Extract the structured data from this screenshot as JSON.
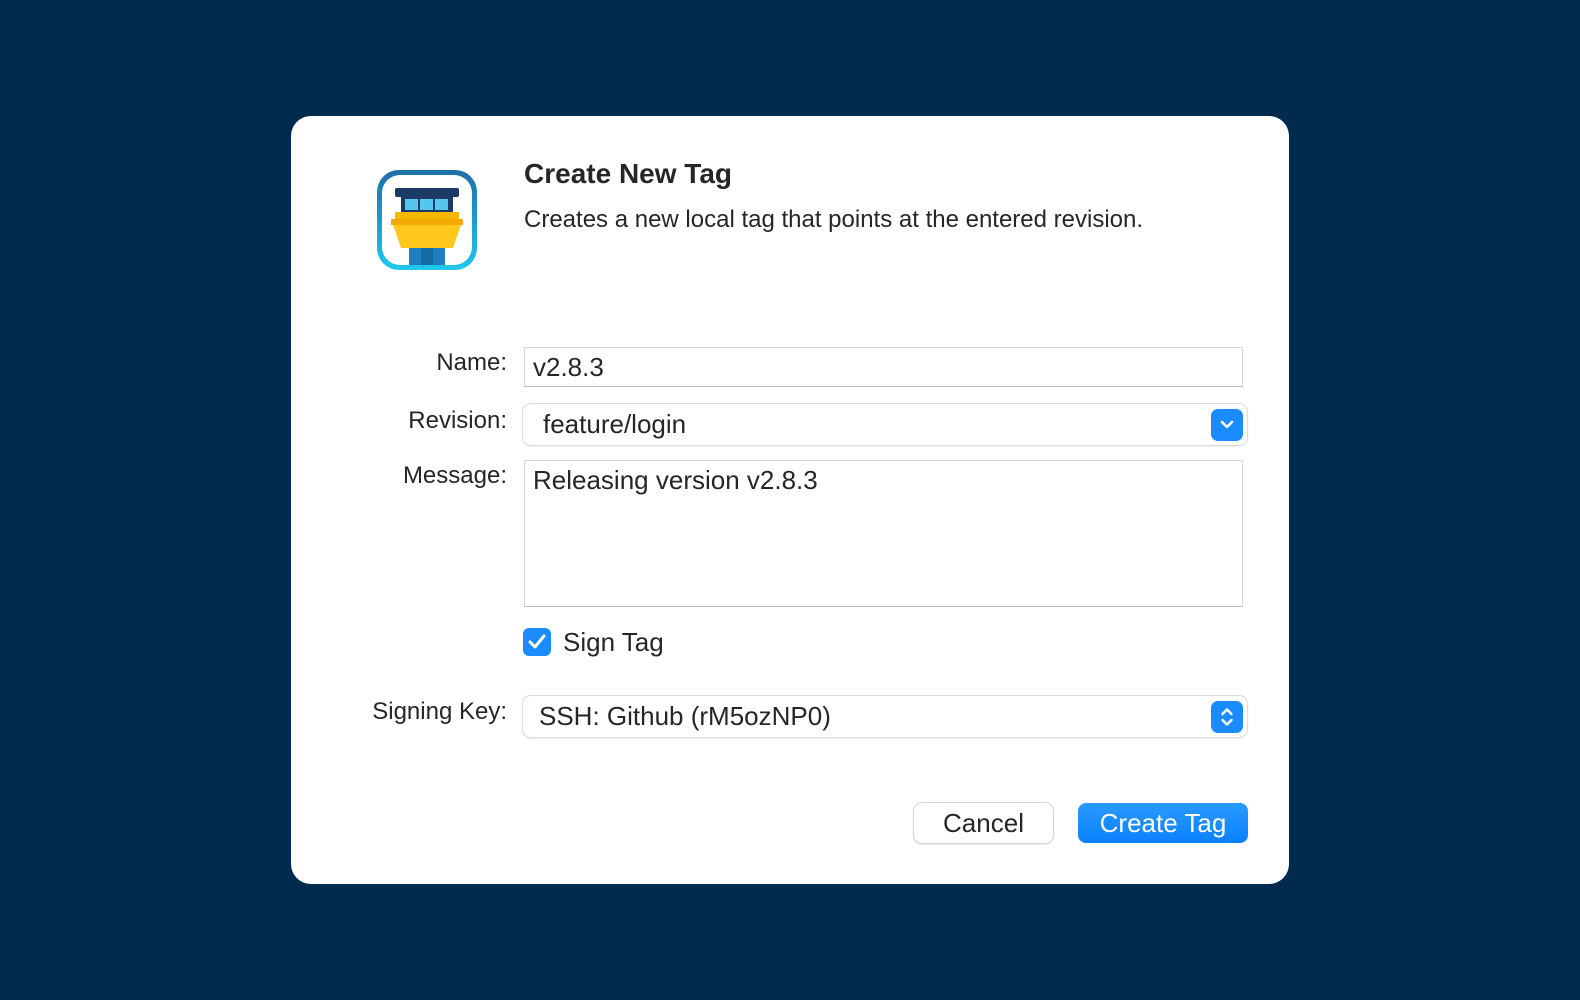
{
  "dialog": {
    "title": "Create New Tag",
    "subtitle": "Creates a new local tag that points at the entered revision."
  },
  "form": {
    "name_label": "Name:",
    "name_value": "v2.8.3",
    "revision_label": "Revision:",
    "revision_value": "feature/login",
    "message_label": "Message:",
    "message_value": "Releasing version v2.8.3",
    "sign_tag_label": "Sign Tag",
    "sign_tag_checked": true,
    "signing_key_label": "Signing Key:",
    "signing_key_value": "SSH: Github (rM5ozNP0)"
  },
  "buttons": {
    "cancel_label": "Cancel",
    "create_label": "Create Tag"
  },
  "icons": {
    "app": "tower-app-icon",
    "revision_popup": "chevron-down-icon",
    "key_popup": "up-down-chevron-icon",
    "checkbox": "checkmark-icon"
  },
  "colors": {
    "background": "#002b4f",
    "accent": "#1a8cff",
    "dialog": "#ffffff",
    "text": "#262626"
  }
}
